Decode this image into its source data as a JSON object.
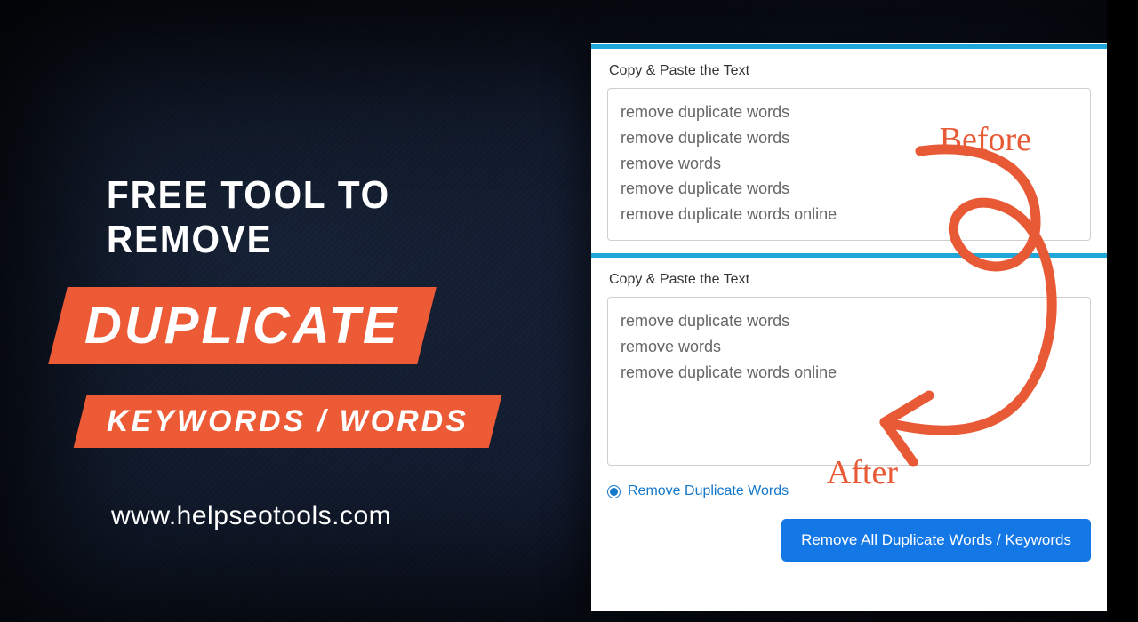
{
  "headline": {
    "line1": "FREE TOOL TO REMOVE",
    "pill1": "DUPLICATE",
    "pill2": "KEYWORDS / WORDS",
    "url": "www.helpseotools.com"
  },
  "beforeCard": {
    "label": "Copy & Paste the Text",
    "lines": [
      "remove duplicate words",
      "remove duplicate words",
      "remove words",
      "remove duplicate words",
      "remove duplicate words online"
    ]
  },
  "afterCard": {
    "label": "Copy & Paste the Text",
    "lines": [
      "remove duplicate words",
      "remove words",
      "remove duplicate words online"
    ]
  },
  "option": {
    "label": "Remove Duplicate Words"
  },
  "button": {
    "label": "Remove All Duplicate Words / Keywords"
  },
  "annot": {
    "before": "Before",
    "after": "After"
  },
  "colors": {
    "accent": "#ec5a36",
    "blue": "#1477e6",
    "teal": "#1ea7d8"
  }
}
